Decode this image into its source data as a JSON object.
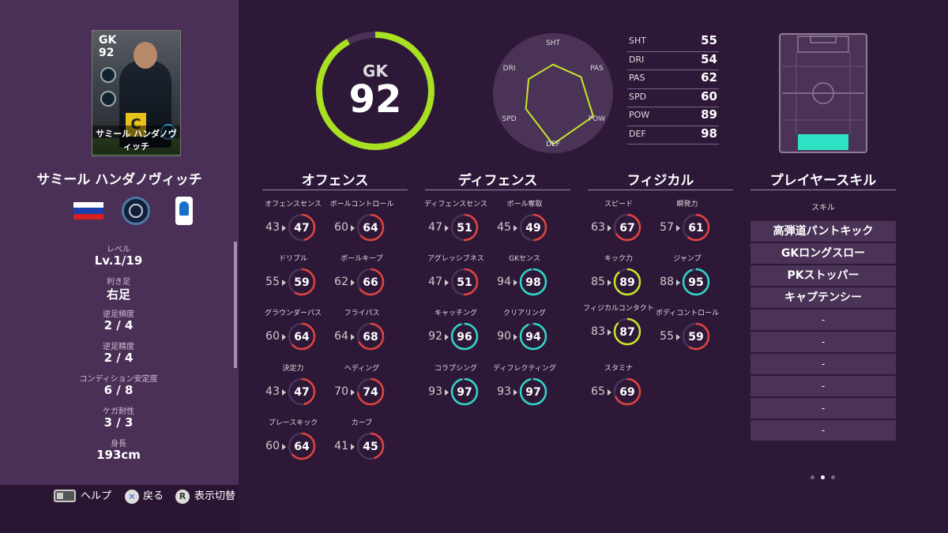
{
  "card": {
    "position": "GK",
    "overall": "92",
    "captain": "C",
    "name": "サミール ハンダノヴィッチ"
  },
  "player": {
    "name": "サミール ハンダノヴィッチ",
    "info": [
      {
        "label": "レベル",
        "value": "Lv.1/19"
      },
      {
        "label": "利き足",
        "value": "右足"
      },
      {
        "label": "逆足頻度",
        "value": "2 / 4"
      },
      {
        "label": "逆足精度",
        "value": "2 / 4"
      },
      {
        "label": "コンディション安定度",
        "value": "6 / 8"
      },
      {
        "label": "ケガ耐性",
        "value": "3 / 3"
      },
      {
        "label": "身長",
        "value": "193cm"
      }
    ]
  },
  "overall": {
    "position": "GK",
    "value": "92",
    "fill": 0.92,
    "color": "#a8e022"
  },
  "radar": {
    "labels": [
      "SHT",
      "PAS",
      "POW",
      "DEF",
      "SPD",
      "DRI"
    ],
    "values": [
      55,
      62,
      89,
      98,
      60,
      54
    ],
    "color": "#c5e82a"
  },
  "summary": [
    {
      "label": "SHT",
      "value": "55"
    },
    {
      "label": "DRI",
      "value": "54"
    },
    {
      "label": "PAS",
      "value": "62"
    },
    {
      "label": "SPD",
      "value": "60"
    },
    {
      "label": "POW",
      "value": "89"
    },
    {
      "label": "DEF",
      "value": "98"
    }
  ],
  "sections": {
    "offense": "オフェンス",
    "defense": "ディフェンス",
    "physical": "フィジカル",
    "skills": "プレイヤースキル"
  },
  "stats": {
    "offense": [
      {
        "label": "オフェンスセンス",
        "base": "43",
        "value": "47"
      },
      {
        "label": "ボールコントロール",
        "base": "60",
        "value": "64"
      },
      {
        "label": "ドリブル",
        "base": "55",
        "value": "59"
      },
      {
        "label": "ボールキープ",
        "base": "62",
        "value": "66"
      },
      {
        "label": "グラウンダーパス",
        "base": "60",
        "value": "64"
      },
      {
        "label": "フライパス",
        "base": "64",
        "value": "68"
      },
      {
        "label": "決定力",
        "base": "43",
        "value": "47"
      },
      {
        "label": "ヘディング",
        "base": "70",
        "value": "74"
      },
      {
        "label": "プレースキック",
        "base": "60",
        "value": "64"
      },
      {
        "label": "カーブ",
        "base": "41",
        "value": "45"
      }
    ],
    "defense": [
      {
        "label": "ディフェンスセンス",
        "base": "47",
        "value": "51"
      },
      {
        "label": "ボール奪取",
        "base": "45",
        "value": "49"
      },
      {
        "label": "アグレッシブネス",
        "base": "47",
        "value": "51"
      },
      {
        "label": "GKセンス",
        "base": "94",
        "value": "98"
      },
      {
        "label": "キャッチング",
        "base": "92",
        "value": "96"
      },
      {
        "label": "クリアリング",
        "base": "90",
        "value": "94"
      },
      {
        "label": "コラプシング",
        "base": "93",
        "value": "97"
      },
      {
        "label": "ディフレクティング",
        "base": "93",
        "value": "97"
      }
    ],
    "physical": [
      {
        "label": "スピード",
        "base": "63",
        "value": "67"
      },
      {
        "label": "瞬発力",
        "base": "57",
        "value": "61"
      },
      {
        "label": "キック力",
        "base": "85",
        "value": "89"
      },
      {
        "label": "ジャンプ",
        "base": "88",
        "value": "95"
      },
      {
        "label": "フィジカルコンタクト",
        "base": "83",
        "value": "87"
      },
      {
        "label": "ボディコントロール",
        "base": "55",
        "value": "59"
      },
      {
        "label": "スタミナ",
        "base": "65",
        "value": "69"
      }
    ]
  },
  "skills": {
    "header": "スキル",
    "items": [
      "高弾道パントキック",
      "GKロングスロー",
      "PKストッパー",
      "キャプテンシー",
      "-",
      "-",
      "-",
      "-",
      "-",
      "-"
    ]
  },
  "controls": {
    "help": "ヘルプ",
    "back_icon": "×",
    "back": "戻る",
    "toggle_icon": "R",
    "toggle": "表示切替"
  },
  "colors": {
    "red": "#e0443e",
    "yellow_green": "#c5e82a",
    "cyan": "#2fd8c8",
    "track": "#4a3356"
  }
}
